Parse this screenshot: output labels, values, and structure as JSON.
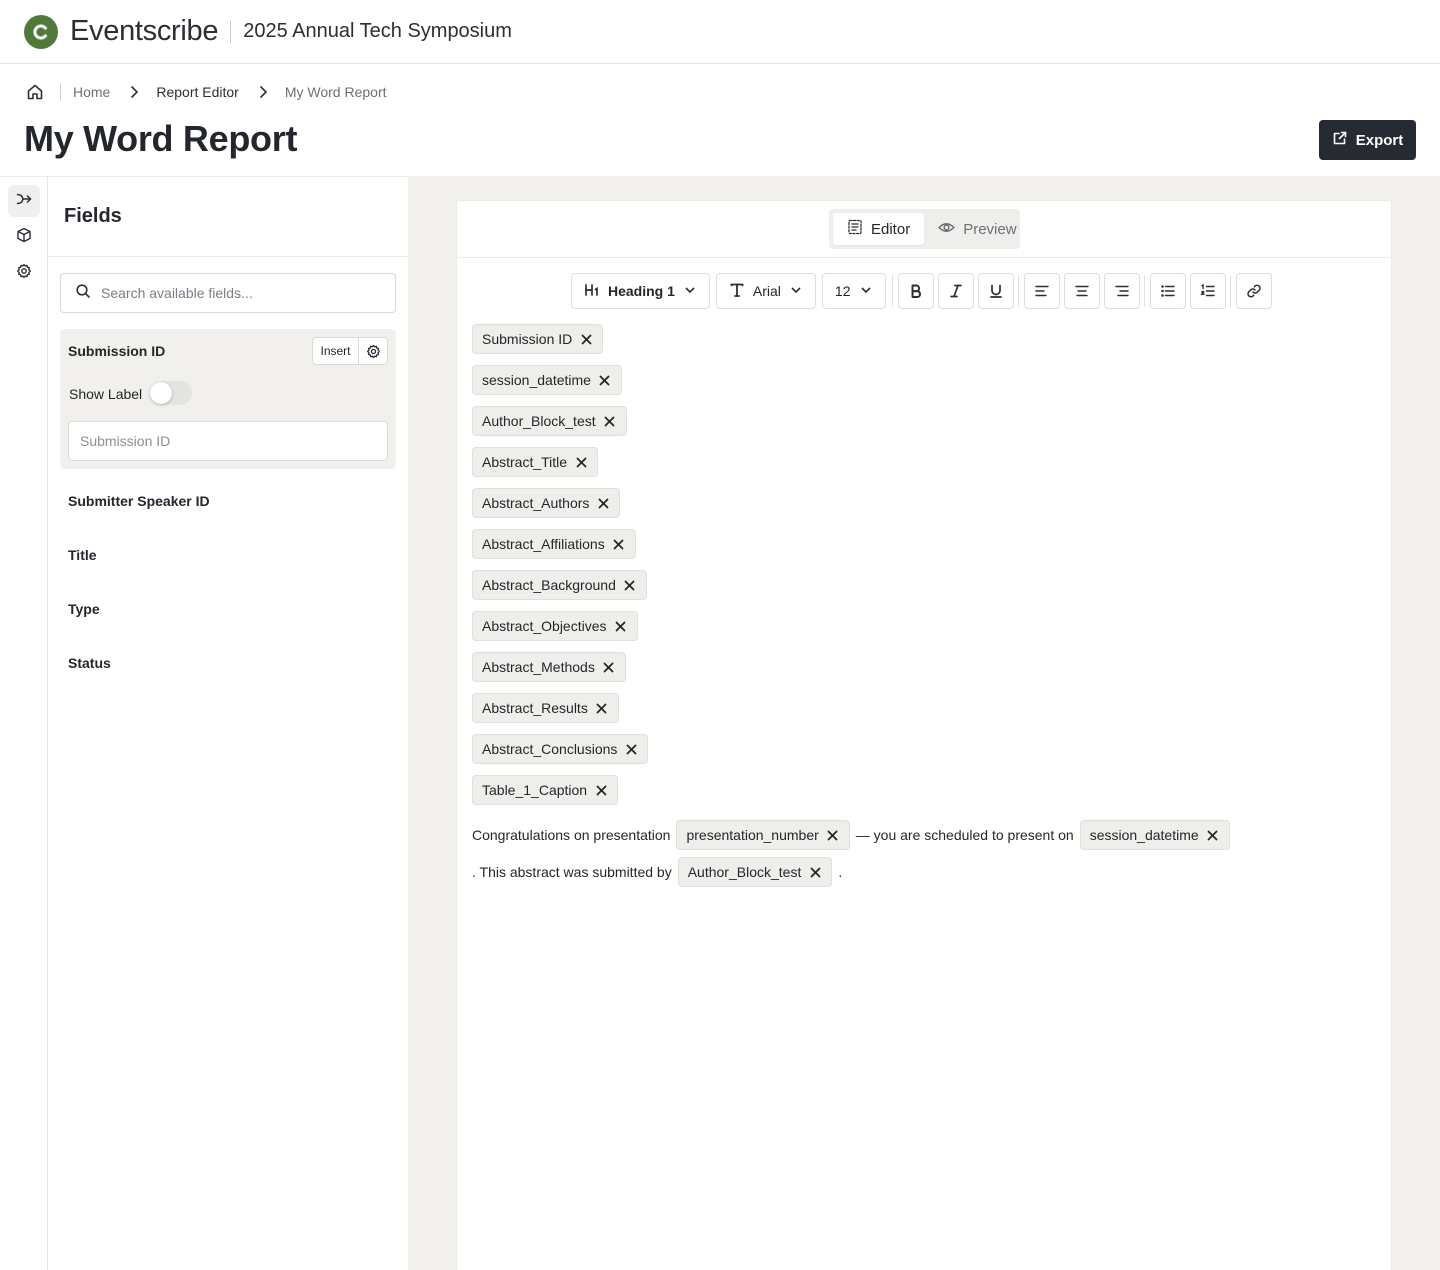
{
  "app": {
    "brand": "Eventscribe",
    "event_name": "2025 Annual Tech Symposium",
    "accent_color": "#4f7a3a"
  },
  "breadcrumb": {
    "home_icon": "home-icon",
    "items": [
      "Home",
      "Report Editor",
      "My Word Report"
    ]
  },
  "page": {
    "title": "My Word Report",
    "export_label": "Export"
  },
  "rail": {
    "icons": [
      "fields-flow-icon",
      "cube-icon",
      "gear-icon"
    ]
  },
  "fields_panel": {
    "title": "Fields",
    "search_placeholder": "Search available fields...",
    "selected": {
      "name": "Submission ID",
      "insert_label": "Insert",
      "show_label": "Show Label",
      "show_label_on": false,
      "input_placeholder": "Submission ID"
    },
    "items": [
      "Submitter Speaker ID",
      "Title",
      "Type",
      "Status"
    ]
  },
  "editor": {
    "modes": [
      "Editor",
      "Preview"
    ],
    "active_mode": "Editor",
    "toolbar": {
      "heading": "Heading 1",
      "font": "Arial",
      "size": "12"
    },
    "chips": [
      "Submission ID",
      "session_datetime",
      "Author_Block_test",
      "Abstract_Title",
      "Abstract_Authors",
      "Abstract_Affiliations",
      "Abstract_Background",
      "Abstract_Objectives",
      "Abstract_Methods",
      "Abstract_Results",
      "Abstract_Conclusions",
      "Table_1_Caption"
    ],
    "paragraph": {
      "line1_text1": "Congratulations on presentation",
      "line1_chip1": "presentation_number",
      "line1_text2": "— you are scheduled to present on",
      "line1_chip2": "session_datetime",
      "line2_text1": ". This abstract was submitted by",
      "line2_chip1": "Author_Block_test",
      "line2_text2": "."
    }
  }
}
